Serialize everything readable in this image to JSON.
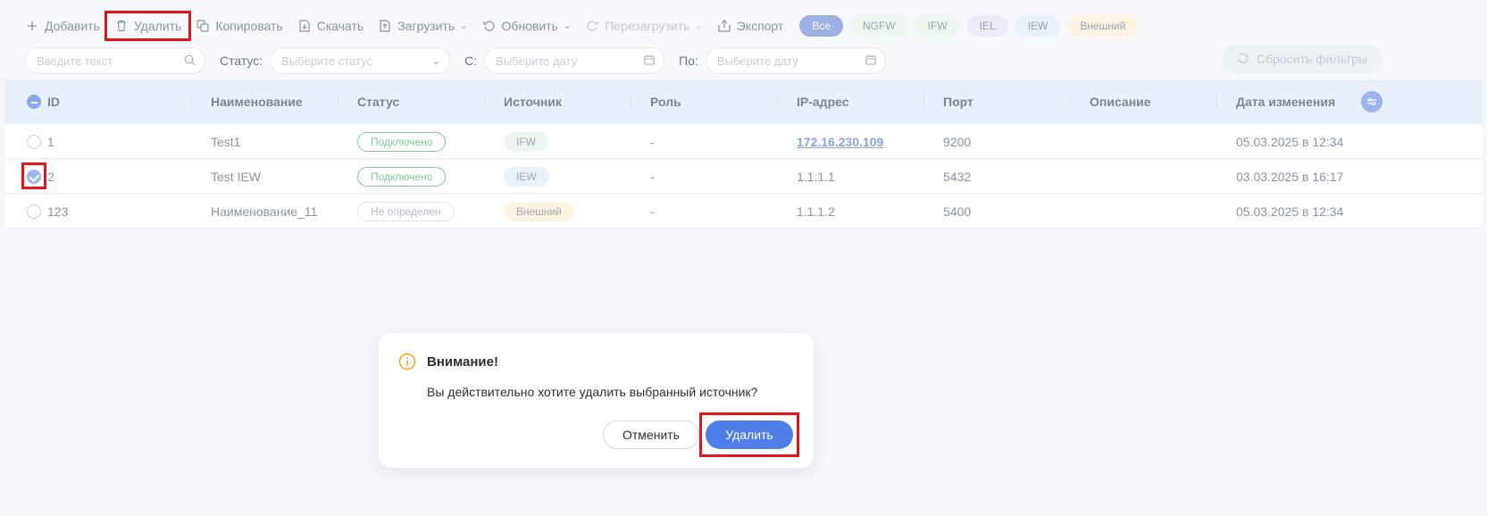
{
  "toolbar": {
    "add": "Добавить",
    "delete": "Удалить",
    "copy": "Копировать",
    "download": "Скачать",
    "upload": "Загрузить",
    "refresh": "Обновить",
    "restart": "Перезагрузить",
    "export": "Экспорт",
    "chips": [
      "Все",
      "NGFW",
      "IFW",
      "IEL",
      "IEW",
      "Внешний"
    ]
  },
  "filters": {
    "search_placeholder": "Введите текст",
    "status_label": "Статус:",
    "status_placeholder": "Выберите статус",
    "from_label": "С:",
    "from_placeholder": "Выберите дату",
    "to_label": "По:",
    "to_placeholder": "Выберите дату",
    "reset": "Сбросить фильтры"
  },
  "table": {
    "headers": [
      "ID",
      "Наименование",
      "Статус",
      "Источник",
      "Роль",
      "IP-адрес",
      "Порт",
      "Описание",
      "Дата изменения"
    ],
    "rows": [
      {
        "id": "1",
        "name": "Test1",
        "status": "Подключено",
        "source": "IFW",
        "role": "-",
        "ip": "172.16.230.109",
        "port": "9200",
        "desc": "",
        "date": "05.03.2025 в 12:34"
      },
      {
        "id": "2",
        "name": "Test IEW",
        "status": "Подключено",
        "source": "IEW",
        "role": "-",
        "ip": "1.1.1.1",
        "port": "5432",
        "desc": "",
        "date": "03.03.2025 в 16:17"
      },
      {
        "id": "123",
        "name": "Наименование_11",
        "status": "Не определен",
        "source": "Внешний",
        "role": "-",
        "ip": "1.1.1.2",
        "port": "5400",
        "desc": "",
        "date": "05.03.2025 в 12:34"
      }
    ]
  },
  "dialog": {
    "title": "Внимание!",
    "message": "Вы действительно хотите удалить выбранный источник?",
    "cancel": "Отменить",
    "confirm": "Удалить"
  },
  "colors": {
    "accent": "#4f7ee8",
    "highlight": "#e3141b",
    "connected": "#7fc99a"
  }
}
